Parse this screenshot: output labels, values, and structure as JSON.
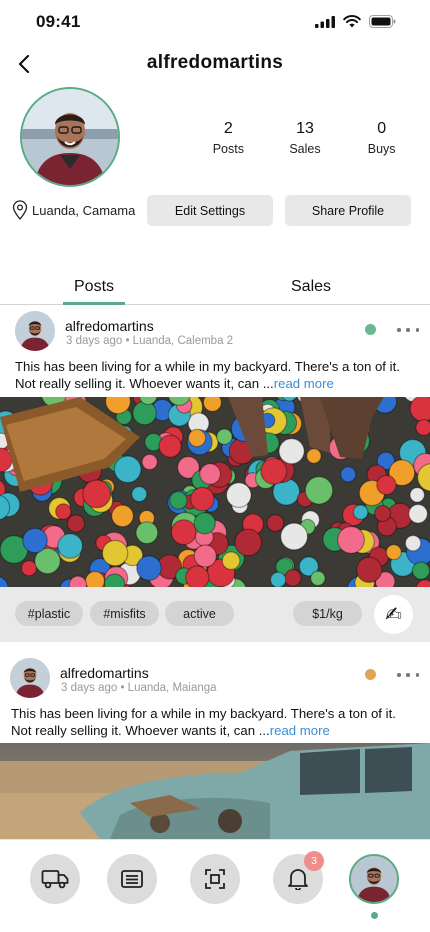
{
  "status_bar": {
    "time": "09:41"
  },
  "header": {
    "back_icon": "chevron-left-icon",
    "username": "alfredomartins"
  },
  "profile": {
    "stats": [
      {
        "value": "2",
        "label": "Posts"
      },
      {
        "value": "13",
        "label": "Sales"
      },
      {
        "value": "0",
        "label": "Buys"
      }
    ],
    "location": "Luanda, Camama",
    "edit_settings_label": "Edit Settings",
    "share_profile_label": "Share Profile"
  },
  "tabs": [
    {
      "label": "Posts",
      "active": true
    },
    {
      "label": "Sales",
      "active": false
    }
  ],
  "colors": {
    "accent": "#58ab85",
    "status_active": "#6cb88e",
    "status_pending": "#e2a452",
    "link": "#3a8ed4",
    "badge": "#ef8d8d"
  },
  "posts": [
    {
      "author": "alfredomartins",
      "meta": "3 days ago • Luanda, Calemba 2",
      "status_color": "#6cb88e",
      "text": "This has been living for a while in my backyard. There's a ton of it. Not really selling it. Whoever wants it, can ...",
      "read_more": "read more",
      "tags": [
        "#plastic",
        "#misfits",
        "active"
      ],
      "price": "$1/kg",
      "chat_icon": "writing-hand-icon"
    },
    {
      "author": "alfredomartins",
      "meta": "3 days ago • Luanda,  Maianga",
      "status_color": "#e2a452",
      "text": "This has been living for a while in my backyard. There's a ton of it. Not really selling it. Whoever wants it, can ...",
      "read_more": "read more"
    }
  ],
  "bottom_nav": {
    "items": [
      {
        "icon": "truck-icon"
      },
      {
        "icon": "list-icon"
      },
      {
        "icon": "scan-icon"
      },
      {
        "icon": "bell-icon",
        "badge": "3"
      },
      {
        "icon": "profile-avatar"
      }
    ]
  }
}
